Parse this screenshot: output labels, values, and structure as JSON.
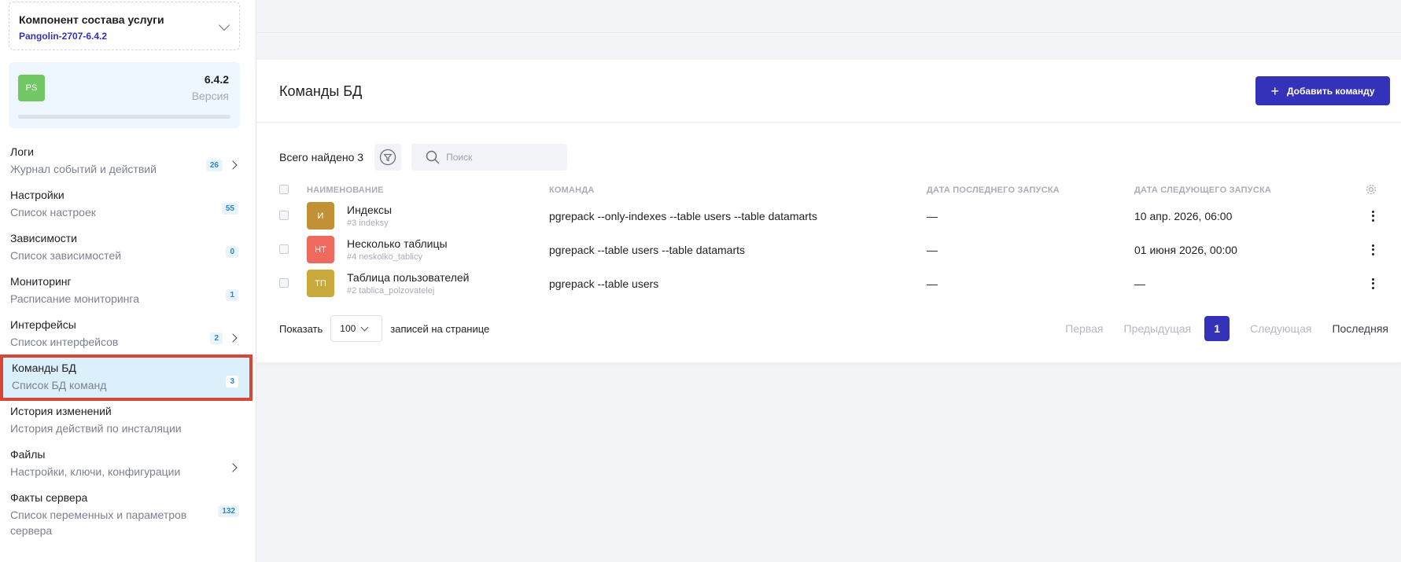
{
  "component": {
    "title": "Компонент состава услуги",
    "subtitle": "Pangolin-2707-6.4.2"
  },
  "version_card": {
    "avatar": "PS",
    "version": "6.4.2",
    "version_label": "Версия",
    "progress": 0
  },
  "sidebar": {
    "items": [
      {
        "label": "Логи",
        "desc": "Журнал событий и действий",
        "badge": "26"
      },
      {
        "label": "Настройки",
        "desc": "Список настроек",
        "badge": "55"
      },
      {
        "label": "Зависимости",
        "desc": "Список зависимостей",
        "badge": "0"
      },
      {
        "label": "Мониторинг",
        "desc": "Расписание мониторинга",
        "badge": "1"
      },
      {
        "label": "Интерфейсы",
        "desc": "Список интерфейсов",
        "badge": "2"
      },
      {
        "label": "Команды БД",
        "desc": "Список БД команд",
        "badge": "3"
      },
      {
        "label": "История изменений",
        "desc": "История действий по инсталяции"
      },
      {
        "label": "Файлы",
        "desc": "Настройки, ключи, конфигурации"
      },
      {
        "label": "Факты сервера",
        "desc": "Список переменных и параметров сервера",
        "badge": "132"
      }
    ]
  },
  "main": {
    "title": "Команды БД",
    "add_button": "Добавить команду",
    "found_text": "Всего найдено 3",
    "search_placeholder": "Поиск",
    "columns": {
      "name": "НАИМЕНОВАНИЕ",
      "command": "КОМАНДА",
      "last_run": "ДАТА ПОСЛЕДНЕГО ЗАПУСКА",
      "next_run": "ДАТА СЛЕДУЮЩЕГО ЗАПУСКА"
    },
    "rows": [
      {
        "avatar": "И",
        "avatar_color": "#c39135",
        "name": "Индексы",
        "slug": "#3 indeksy",
        "command": "pgrepack --only-indexes --table users --table datamarts",
        "last_run": "—",
        "next_run": "10 апр. 2026, 06:00"
      },
      {
        "avatar": "НТ",
        "avatar_color": "#ee6a5e",
        "name": "Несколько таблицы",
        "slug": "#4 neskolko_tablicy",
        "command": "pgrepack --table users --table datamarts",
        "last_run": "—",
        "next_run": "01 июня 2026, 00:00"
      },
      {
        "avatar": "ТП",
        "avatar_color": "#c9a83c",
        "name": "Таблица пользователей",
        "slug": "#2 tablica_polzovatelej",
        "command": "pgrepack --table users",
        "last_run": "—",
        "next_run": "—"
      }
    ],
    "pagination": {
      "show": "Показать",
      "per_page": "100",
      "per_page_suffix": "записей на странице",
      "first": "Первая",
      "prev": "Предыдущая",
      "current": "1",
      "next": "Следующая",
      "last": "Последняя"
    }
  },
  "colors": {
    "accent": "#3432b8",
    "active_bg": "#dcf0fb",
    "highlight": "#d84636",
    "badge_text": "#2c86c6"
  }
}
